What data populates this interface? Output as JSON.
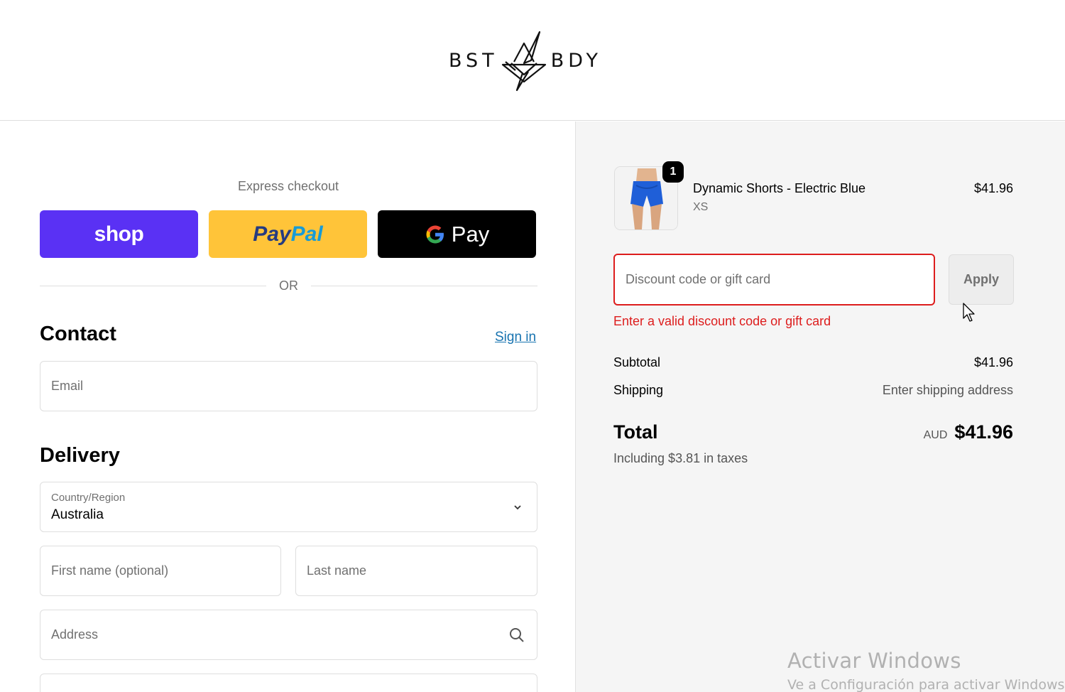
{
  "header": {
    "logo_left": "BST",
    "logo_right": "BDY"
  },
  "express": {
    "title": "Express checkout",
    "shop_label": "shop",
    "paypal_label_1": "Pay",
    "paypal_label_2": "Pal",
    "gpay_label": "Pay",
    "or_label": "OR"
  },
  "contact": {
    "heading": "Contact",
    "sign_in": "Sign in",
    "email_placeholder": "Email"
  },
  "delivery": {
    "heading": "Delivery",
    "country_label": "Country/Region",
    "country_value": "Australia",
    "first_name_placeholder": "First name (optional)",
    "last_name_placeholder": "Last name",
    "address_placeholder": "Address"
  },
  "summary": {
    "quantity": "1",
    "product_name": "Dynamic Shorts - Electric Blue",
    "variant": "XS",
    "product_price": "$41.96",
    "discount_placeholder": "Discount code or gift card",
    "apply_label": "Apply",
    "error_message": "Enter a valid discount code or gift card",
    "subtotal_label": "Subtotal",
    "subtotal_value": "$41.96",
    "shipping_label": "Shipping",
    "shipping_value": "Enter shipping address",
    "total_label": "Total",
    "currency": "AUD",
    "total_value": "$41.96",
    "taxes_note": "Including $3.81 in taxes"
  },
  "watermark": {
    "title": "Activar Windows",
    "subtitle": "Ve a Configuración para activar Windows."
  },
  "colors": {
    "shop": "#5a31f4",
    "paypal": "#ffc439",
    "gpay": "#000000",
    "link": "#1773b0",
    "error": "#dd1d1d",
    "summary_bg": "#f5f5f5"
  }
}
